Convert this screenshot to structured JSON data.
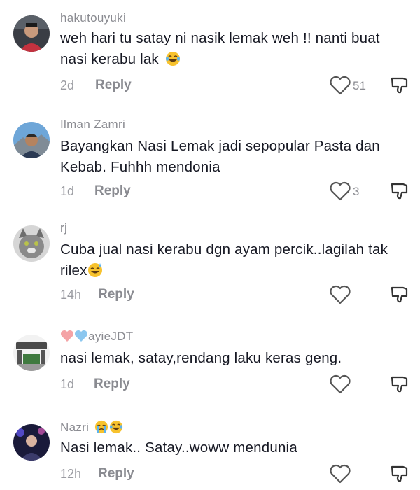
{
  "comments": [
    {
      "username": "hakutouyuki",
      "text": "weh hari tu satay ni nasik lemak weh !! nanti buat nasi kerabu lak",
      "emoji": "tears-of-joy",
      "time": "2d",
      "reply_label": "Reply",
      "likes": "51"
    },
    {
      "username": "Ilman Zamri",
      "text": "Bayangkan Nasi Lemak jadi sepopular Pasta dan Kebab. Fuhhh mendonia",
      "time": "1d",
      "reply_label": "Reply",
      "likes": "3"
    },
    {
      "username": "rj",
      "text": "Cuba jual nasi kerabu dgn ayam percik..lagilah tak rilex",
      "emoji": "grinning-sweat",
      "time": "14h",
      "reply_label": "Reply",
      "likes": ""
    },
    {
      "username": "ayieJDT",
      "username_prefix_icons": [
        "pink-heart",
        "light-blue-heart"
      ],
      "text": "nasi lemak, satay,rendang laku keras geng.",
      "time": "1d",
      "reply_label": "Reply",
      "likes": ""
    },
    {
      "username": "Nazri",
      "username_suffix_icons": [
        "crying-face",
        "tears-of-joy"
      ],
      "text": "Nasi lemak.. Satay..woww mendunia",
      "time": "12h",
      "reply_label": "Reply",
      "likes": ""
    }
  ],
  "colors": {
    "text": "#161823",
    "secondary": "#8a8b91",
    "emoji_yellow": "#f7c22d"
  },
  "icons": {
    "like": "heart-outline-icon",
    "dislike": "thumbs-down-icon"
  }
}
